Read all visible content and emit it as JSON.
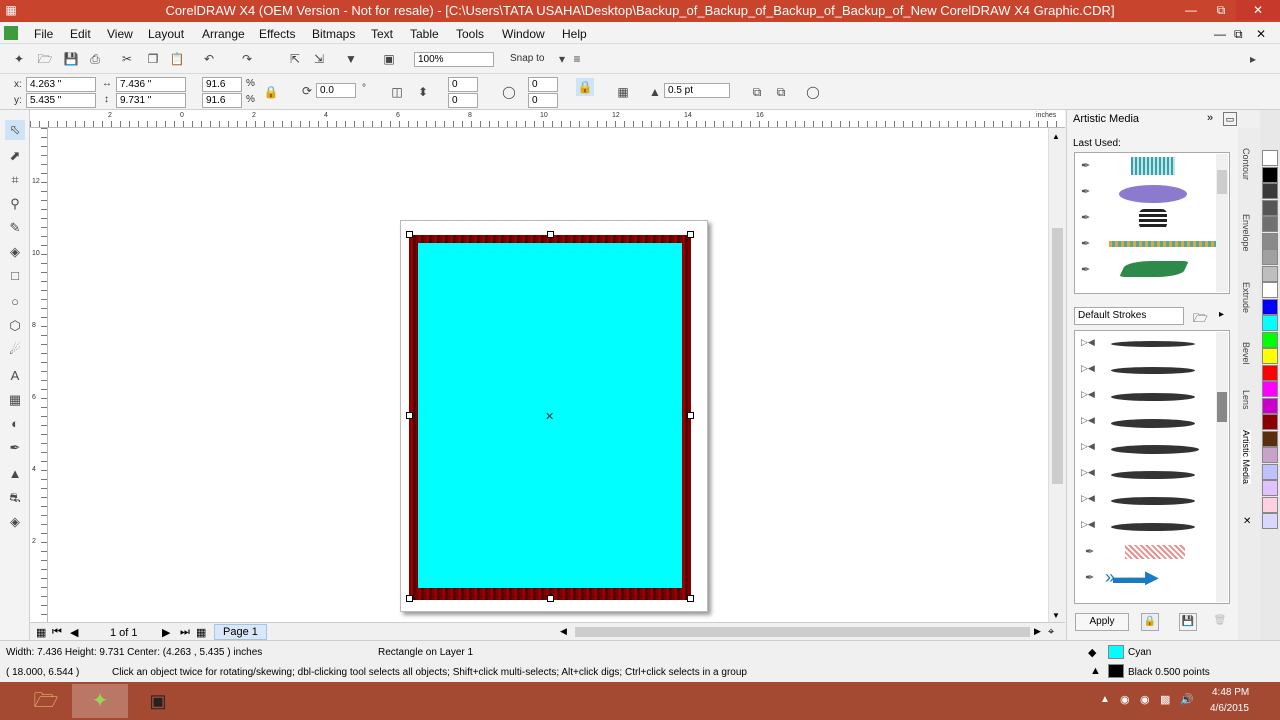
{
  "title": "CorelDRAW X4 (OEM Version - Not for resale) - [C:\\Users\\TATA USAHA\\Desktop\\Backup_of_Backup_of_Backup_of_Backup_of_New CorelDRAW X4 Graphic.CDR]",
  "menu": [
    "File",
    "Edit",
    "View",
    "Layout",
    "Arrange",
    "Effects",
    "Bitmaps",
    "Text",
    "Table",
    "Tools",
    "Window",
    "Help"
  ],
  "toolbar": {
    "zoom": "100%",
    "snap_to": "Snap to"
  },
  "props": {
    "x": "4.263 \"",
    "y": "5.435 \"",
    "w": "7.436 \"",
    "h": "9.731 \"",
    "scale_x": "91.6",
    "scale_y": "91.6",
    "pct": "%",
    "rotate": "0.0",
    "deg": "°",
    "corner1": "0",
    "corner2": "0",
    "corner3": "0",
    "corner4": "0",
    "outline": "0.5 pt"
  },
  "ruler": {
    "unit": "inches",
    "top": [
      "2",
      "0",
      "2",
      "4",
      "6",
      "8",
      "10",
      "12",
      "14",
      "16"
    ],
    "left": [
      "12",
      "10",
      "8",
      "6",
      "4",
      "2"
    ]
  },
  "docker": {
    "title": "Artistic Media",
    "last_used": "Last Used:",
    "strokes_select": "Default Strokes",
    "apply": "Apply"
  },
  "docker_tabs": [
    "Contour",
    "Envelope",
    "Extrude",
    "Bevel",
    "Lens",
    "Artistic Media"
  ],
  "page_nav": {
    "count": "1 of 1",
    "page_tab": "Page 1"
  },
  "status": {
    "dims": "Width: 7.436  Height: 9.731  Center: (4.263 , 5.435 )  inches",
    "object": "Rectangle on Layer 1",
    "cursor": "( 18.000, 6.544 )",
    "hint": "Click an object twice for rotating/skewing; dbl-clicking tool selects all objects; Shift+click multi-selects; Alt+click digs; Ctrl+click selects in a group",
    "fill_name": "Cyan",
    "outline_desc": "Black  0.500 points"
  },
  "clock": {
    "time": "4:48 PM",
    "date": "4/6/2015"
  },
  "colors": {
    "title": "#c9442c",
    "fill": "#00ffff",
    "border": "#8b0000",
    "taskbar": "#a54a32"
  },
  "palette": [
    "#ffffff",
    "#000000",
    "#3a3a3a",
    "#555555",
    "#707070",
    "#8a8a8a",
    "#a0a0a0",
    "#bebebe",
    "#ffffff",
    "#0000ff",
    "#00ffff",
    "#00ff00",
    "#ffff00",
    "#ff0000",
    "#ff00ff",
    "#cc00cc",
    "#8b0000",
    "#5a2d0c",
    "#c8a2c8",
    "#c0c0ff",
    "#e0c0ff",
    "#ffd0e0",
    "#d8d8ff"
  ]
}
